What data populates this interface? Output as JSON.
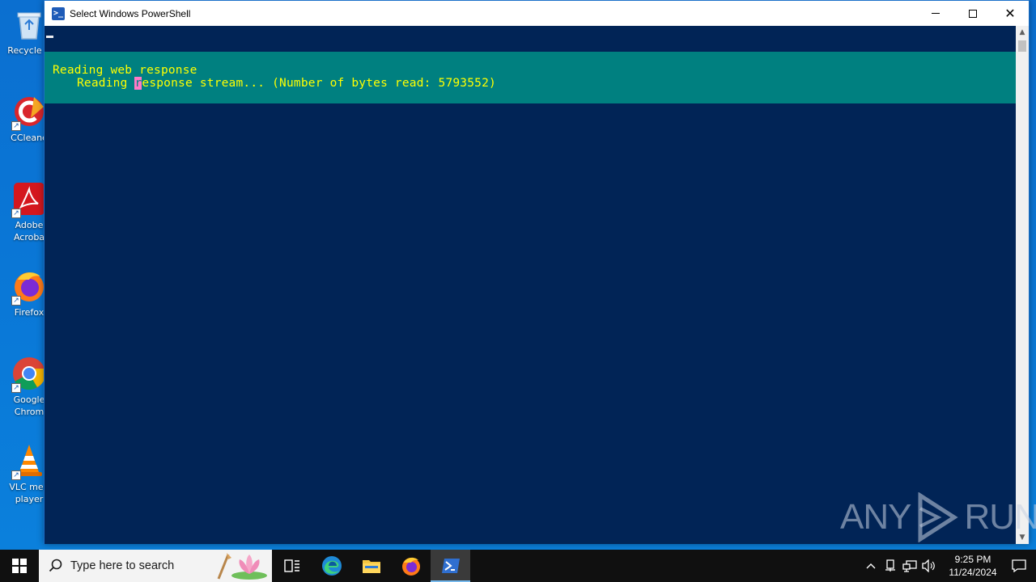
{
  "desktop": {
    "icons": [
      {
        "label": "Recycle B",
        "icon": "recycle-bin-icon"
      },
      {
        "label": "CCleane",
        "icon": "ccleaner-icon"
      },
      {
        "label": "Adobe\nAcroba",
        "icon": "adobe-acrobat-icon"
      },
      {
        "label": "Firefox",
        "icon": "firefox-icon"
      },
      {
        "label": "Google\nChrom",
        "icon": "chrome-icon"
      },
      {
        "label": "VLC med\nplayer",
        "icon": "vlc-icon"
      }
    ]
  },
  "window": {
    "title": "Select Windows PowerShell",
    "icon": "powershell-icon",
    "progress": {
      "activity": "Reading web response",
      "status_prefix": "Reading ",
      "status_cursor_char": "r",
      "status_suffix": "esponse stream... (Number of bytes read: 5793552)"
    },
    "colors": {
      "console_bg": "#012456",
      "progress_bg": "#008080",
      "progress_text": "#ffff00"
    }
  },
  "watermark": {
    "left": "ANY",
    "right": "RUN"
  },
  "taskbar": {
    "search_placeholder": "Type here to search",
    "apps": [
      "task-view-icon",
      "edge-icon",
      "file-explorer-icon",
      "firefox-icon",
      "powershell-icon"
    ],
    "clock_time": "9:25 PM",
    "clock_date": "11/24/2024"
  }
}
